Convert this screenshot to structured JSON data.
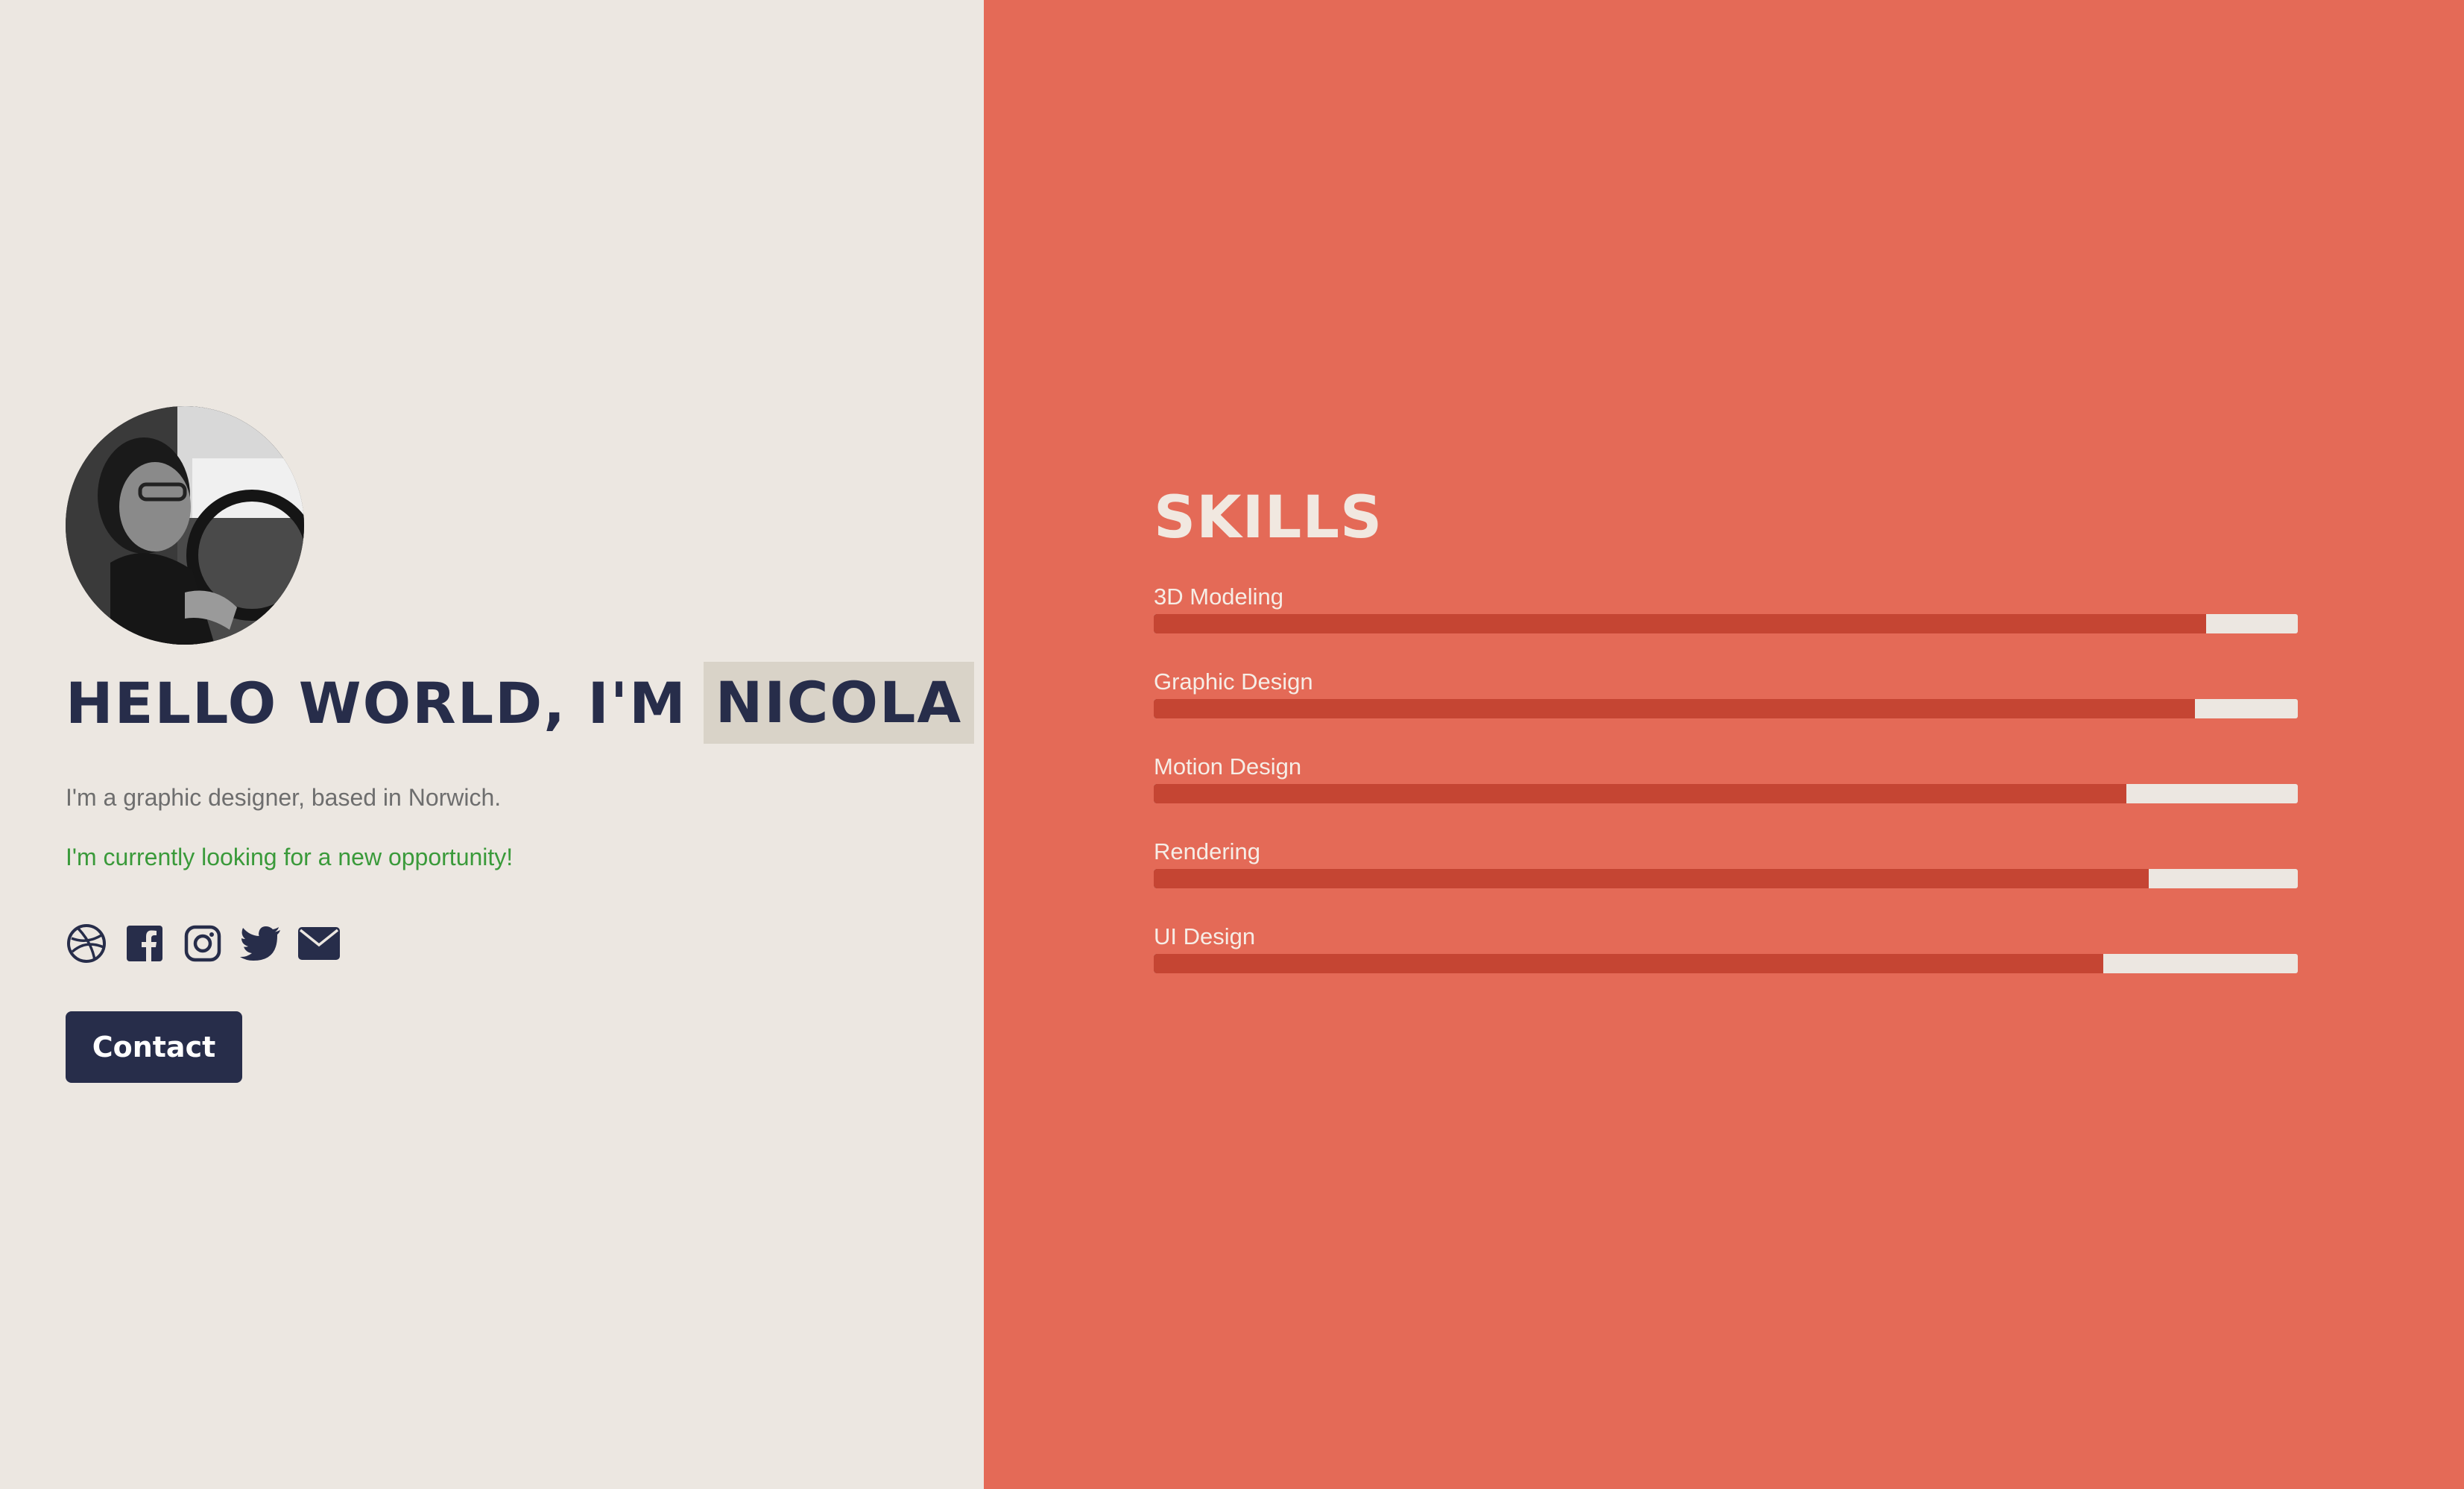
{
  "profile": {
    "greeting": "HELLO WORLD, I'M",
    "name": "NICOLA",
    "description": "I'm a graphic designer, based in Norwich.",
    "opportunity": "I'm currently looking for a new opportunity!",
    "contact_label": "Contact"
  },
  "socials": [
    {
      "icon": "dribbble-icon"
    },
    {
      "icon": "facebook-icon"
    },
    {
      "icon": "instagram-icon"
    },
    {
      "icon": "twitter-icon"
    },
    {
      "icon": "envelope-icon"
    }
  ],
  "skills": {
    "title": "SKILLS",
    "items": [
      {
        "label": "3D Modeling",
        "level": 0.92
      },
      {
        "label": "Graphic Design",
        "level": 0.91
      },
      {
        "label": "Motion Design",
        "level": 0.85
      },
      {
        "label": "Rendering",
        "level": 0.87
      },
      {
        "label": "UI Design",
        "level": 0.83
      }
    ]
  },
  "colors": {
    "left_bg": "#ece7e1",
    "right_bg": "#e46a57",
    "navy": "#272d4a",
    "name_highlight": "#d9d3c8",
    "bar_fill": "#c54533",
    "bar_track": "#ece7e1",
    "opportunity_green": "#3a9a3a"
  }
}
